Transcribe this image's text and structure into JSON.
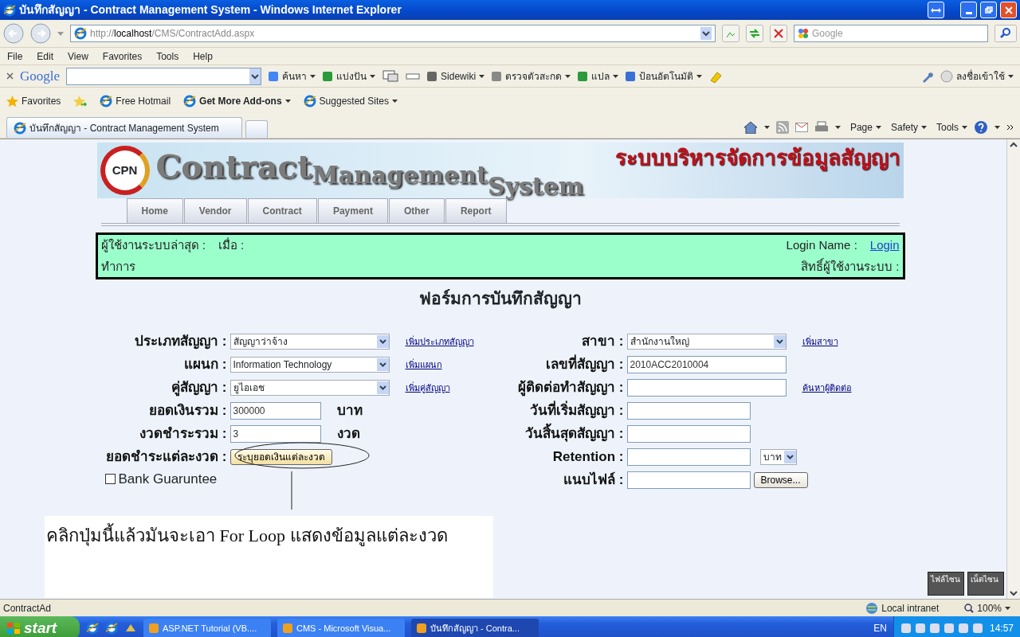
{
  "window": {
    "title": "บันทึกสัญญา - Contract Management System - Windows Internet Explorer"
  },
  "address_bar": {
    "url_prefix": "http://",
    "url_host": "localhost",
    "url_path": "/CMS/ContractAdd.aspx",
    "search_placeholder": "Google"
  },
  "menu": [
    "File",
    "Edit",
    "View",
    "Favorites",
    "Tools",
    "Help"
  ],
  "google_toolbar": {
    "logo": "Google",
    "items": [
      {
        "label": "ค้นหา"
      },
      {
        "label": "แบ่งปัน"
      },
      {
        "label": "Sidewiki"
      },
      {
        "label": "ตรวจตัวสะกด"
      },
      {
        "label": "แปล"
      },
      {
        "label": "ป้อนอัตโนมัติ"
      }
    ],
    "signin": "ลงชื่อเข้าใช้"
  },
  "favorites_bar": {
    "label": "Favorites",
    "links": [
      {
        "label": "Free Hotmail",
        "bold": false
      },
      {
        "label": "Get More Add-ons",
        "bold": true
      },
      {
        "label": "Suggested Sites",
        "bold": false
      }
    ]
  },
  "tabs": [
    {
      "label": "บันทึกสัญญา - Contract Management System",
      "selected": true
    }
  ],
  "command_bar": [
    "Page",
    "Safety",
    "Tools"
  ],
  "banner": {
    "logo": "CPN",
    "word1": "Contract",
    "word2": "Management",
    "word3": "System",
    "thai_title": "ระบบบริหารจัดการข้อมูลสัญญา"
  },
  "site_nav": [
    "Home",
    "Vendor",
    "Contract",
    "Payment",
    "Other",
    "Report"
  ],
  "user_info": {
    "last_user": "ผู้ใช้งานระบบล่าสุด :",
    "when": "เมื่อ :",
    "action": "ทำการ",
    "login_label": "Login Name :",
    "login_link": "Login",
    "rights": "สิทธิ์ผู้ใช้งานระบบ :"
  },
  "form": {
    "title": "ฟอร์มการบันทึกสัญญา",
    "left": [
      {
        "label": "ประเภทสัญญา :",
        "kind": "select",
        "value": "สัญญาว่าจ้าง",
        "link": "เพิ่มประเภทสัญญา"
      },
      {
        "label": "แผนก :",
        "kind": "select",
        "value": "Information Technology",
        "link": "เพิ่มแผนก"
      },
      {
        "label": "คู่สัญญา :",
        "kind": "select",
        "value": "ยูไอเอช",
        "link": "เพิ่มคู่สัญญา"
      },
      {
        "label": "ยอดเงินรวม :",
        "kind": "text",
        "value": "300000",
        "unit": "บาท"
      },
      {
        "label": "งวดชำระรวม :",
        "kind": "text",
        "value": "3",
        "unit": "งวด"
      },
      {
        "label": "ยอดชำระแต่ละงวด :",
        "kind": "button",
        "value": "ระบุยอดเงินแต่ละงวด"
      }
    ],
    "bank_guarantee": {
      "label": "Bank Guaruntee",
      "checked": false
    },
    "right": [
      {
        "label": "สาขา :",
        "kind": "select",
        "value": "สำนักงานใหญ่",
        "link": "เพิ่มสาขา"
      },
      {
        "label": "เลขที่สัญญา :",
        "kind": "text",
        "value": "2010ACC2010004"
      },
      {
        "label": "ผู้ติดต่อทำสัญญา :",
        "kind": "text",
        "link": "ค้นหาผู้ติดต่อ"
      },
      {
        "label": "วันที่เริ่มสัญญา :",
        "kind": "short"
      },
      {
        "label": "วันสิ้นสุดสัญญา :",
        "kind": "short"
      },
      {
        "label": "Retention :",
        "kind": "unit_select",
        "dropdown_value": "บาท"
      },
      {
        "label": "แนบไฟล์ :",
        "kind": "file",
        "button": "Browse..."
      }
    ]
  },
  "callout": {
    "text": "คลิกปุ่มนี้แล้วมันจะเอา For Loop แสดงข้อมูลแต่ละงวด"
  },
  "status_bar": {
    "text": "ContractAd",
    "zone": "Local intranet",
    "zoom": "100%"
  },
  "mini_panel": [
    "ไฟล์ไซน",
    "เน็ตไซน"
  ],
  "taskbar": {
    "start": "start",
    "items": [
      {
        "label": "ASP.NET Tutorial (VB....",
        "selected": false
      },
      {
        "label": "CMS - Microsoft Visua...",
        "selected": false
      },
      {
        "label": "บันทึกสัญญา - Contra...",
        "selected": true
      }
    ],
    "lang": "EN",
    "clock": "14:57"
  }
}
